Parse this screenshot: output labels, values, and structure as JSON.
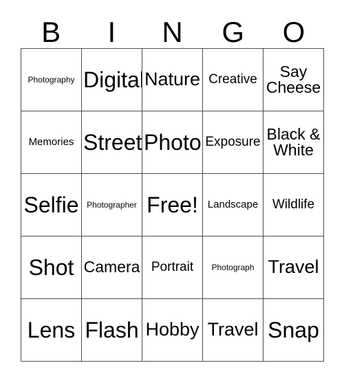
{
  "card": {
    "header_letters": [
      "B",
      "I",
      "N",
      "G",
      "O"
    ],
    "border_color": "#4d4d4d",
    "background_color": "#ffffff",
    "text_color": "#000000",
    "rows": [
      [
        {
          "label": "Photography",
          "size": "fs-xs"
        },
        {
          "label": "Digital",
          "size": "fs-xxl"
        },
        {
          "label": "Nature",
          "size": "fs-xl"
        },
        {
          "label": "Creative",
          "size": "fs-m"
        },
        {
          "label": "Say Cheese",
          "size": "fs-l"
        }
      ],
      [
        {
          "label": "Memories",
          "size": "fs-s"
        },
        {
          "label": "Street",
          "size": "fs-xxl"
        },
        {
          "label": "Photo",
          "size": "fs-xxl"
        },
        {
          "label": "Exposure",
          "size": "fs-m"
        },
        {
          "label": "Black & White",
          "size": "fs-l"
        }
      ],
      [
        {
          "label": "Selfie",
          "size": "fs-xxl"
        },
        {
          "label": "Photographer",
          "size": "fs-xs"
        },
        {
          "label": "Free!",
          "size": "fs-xxl"
        },
        {
          "label": "Landscape",
          "size": "fs-s"
        },
        {
          "label": "Wildlife",
          "size": "fs-m"
        }
      ],
      [
        {
          "label": "Shot",
          "size": "fs-xxl"
        },
        {
          "label": "Camera",
          "size": "fs-l"
        },
        {
          "label": "Portrait",
          "size": "fs-m"
        },
        {
          "label": "Photograph",
          "size": "fs-xs"
        },
        {
          "label": "Travel",
          "size": "fs-xl"
        }
      ],
      [
        {
          "label": "Lens",
          "size": "fs-xxl"
        },
        {
          "label": "Flash",
          "size": "fs-xxl"
        },
        {
          "label": "Hobby",
          "size": "fs-xl"
        },
        {
          "label": "Travel",
          "size": "fs-xl"
        },
        {
          "label": "Snap",
          "size": "fs-xxl"
        }
      ]
    ]
  }
}
